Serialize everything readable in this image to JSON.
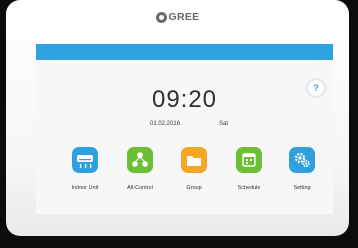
{
  "brand": {
    "name": "GREE"
  },
  "clock": {
    "time": "09:20",
    "date": "01.02.2016",
    "day": "Sat"
  },
  "help": {
    "label": "?"
  },
  "apps": [
    {
      "label": "Indoor Unit",
      "icon": "indoor-unit-icon",
      "color": "#2f9fe0"
    },
    {
      "label": "All-Control",
      "icon": "all-control-icon",
      "color": "#6cbf35"
    },
    {
      "label": "Group",
      "icon": "folder-icon",
      "color": "#f5a623"
    },
    {
      "label": "Schedule",
      "icon": "calendar-icon",
      "color": "#6cbf35"
    },
    {
      "label": "Setting",
      "icon": "gear-icon",
      "color": "#2f9fe0"
    }
  ],
  "colors": {
    "topbar": "#2ea3e0",
    "bezel": "#ffffff"
  }
}
